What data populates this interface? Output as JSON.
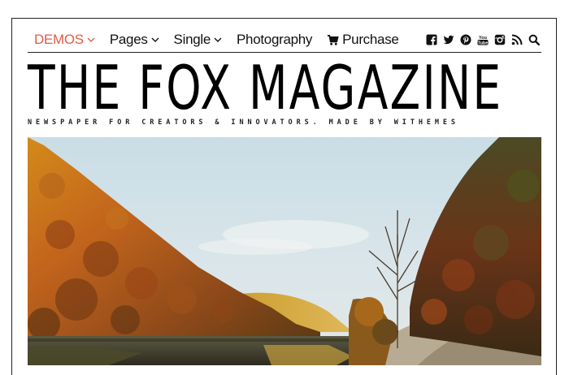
{
  "nav": {
    "items": [
      {
        "label": "DEMOS",
        "dropdown": true,
        "active": true
      },
      {
        "label": "Pages",
        "dropdown": true,
        "active": false
      },
      {
        "label": "Single",
        "dropdown": true,
        "active": false
      },
      {
        "label": "Photography",
        "dropdown": false,
        "active": false
      },
      {
        "label": "Purchase",
        "dropdown": false,
        "active": false,
        "icon": "cart-icon"
      }
    ],
    "social_icons": [
      "facebook-icon",
      "twitter-icon",
      "pinterest-icon",
      "youtube-icon",
      "instagram-icon",
      "rss-icon",
      "search-icon"
    ]
  },
  "masthead": {
    "title": "THE FOX MAGAZINE",
    "tagline": "NEWSPAPER FOR CREATORS & INNOVATORS. MADE BY WITHEMES"
  },
  "hero": {
    "image_alt": "Autumn landscape with a lake and a dirt road between forested hills"
  },
  "colors": {
    "accent": "#e25b45",
    "text": "#111111"
  }
}
